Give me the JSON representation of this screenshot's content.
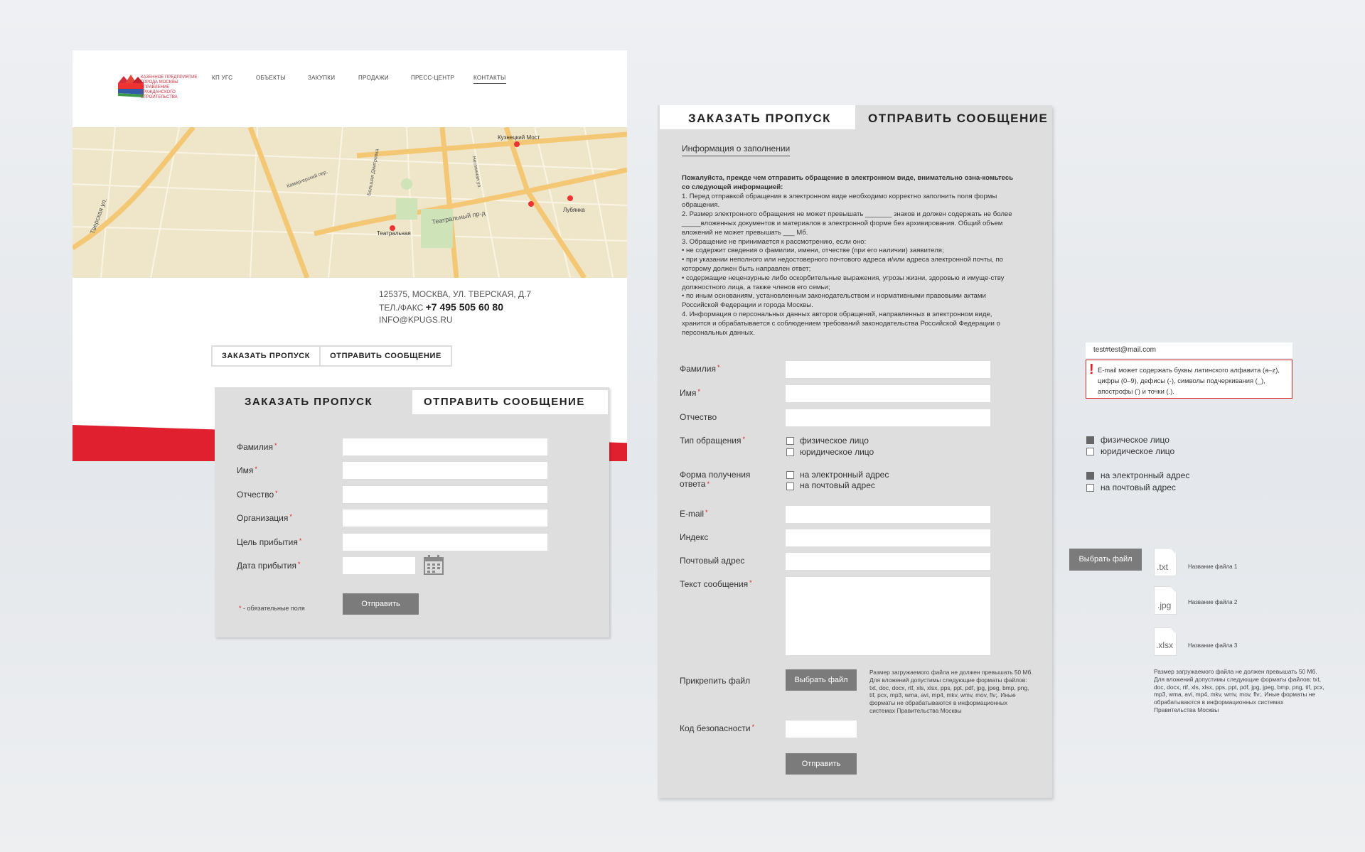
{
  "site": {
    "logo_text": "КАЗЕННОЕ ПРЕДПРИЯТИЕ ГОРОДА МОСКВЫ УПРАВЛЕНИЕ ГРАЖДАНСКОГО СТРОИТЕЛЬСТВА",
    "nav": [
      "КП УГС",
      "ОБЪЕКТЫ",
      "ЗАКУПКИ",
      "ПРОДАЖИ",
      "ПРЕСС-ЦЕНТР",
      "КОНТАКТЫ"
    ],
    "map_labels": [
      "Кузнецкий Мост",
      "Театральная",
      "Театральный пр-д",
      "Тверская ул.",
      "Лубянка",
      "Неглинная ул.",
      "Большая Дмитровка",
      "Камергерский пер."
    ],
    "address": "125375, МОСКВА, УЛ. ТВЕРСКАЯ, Д.7",
    "phone_label": "ТЕЛ./ФАКС",
    "phone": "+7 495 505 60 80",
    "email": "INFO@KPUGS.RU",
    "tab_pass": "ЗАКАЗАТЬ ПРОПУСК",
    "tab_message": "ОТПРАВИТЬ СООБЩЕНИЕ"
  },
  "pass_form": {
    "tab_pass": "ЗАКАЗАТЬ ПРОПУСК",
    "tab_message": "ОТПРАВИТЬ СООБЩЕНИЕ",
    "fields": [
      "Фамилия",
      "Имя",
      "Отчество",
      "Организация",
      "Цель прибытия",
      "Дата прибытия"
    ],
    "required_mark": "*",
    "required_note": "- обязательные поля",
    "submit": "Отправить"
  },
  "message_form": {
    "tab_pass": "ЗАКАЗАТЬ ПРОПУСК",
    "tab_message": "ОТПРАВИТЬ СООБЩЕНИЕ",
    "info_link": "Информация о заполнении",
    "info_heading": "Пожалуйста, прежде чем отправить обращение в электронном виде, внимательно озна-комьтесь со следующей информацией:",
    "info_lines": [
      "1. Перед отправкой обращения в электронном виде необходимо корректно заполнить поля формы обращения.",
      "2. Размер электронного обращения не может превышать _______ знаков и должен содержать не более _____вложенных документов и материалов в электронной форме без архивирования. Общий объем вложений не может превышать ___ Мб.",
      "3. Обращение не принимается к рассмотрению, если оно:",
      "• не содержит сведения о фамилии, имени, отчестве (при его наличии) заявителя;",
      "• при указании неполного или недостоверного почтового адреса и/или адреса электронной почты, по которому должен быть направлен ответ;",
      "• содержащие нецензурные либо оскорбительные выражения, угрозы жизни, здоровью и имуще-ству должностного лица, а также членов его семьи;",
      "• по иным основаниям, установленным законодательством и нормативными правовыми актами Российской Федерации и города Москвы.",
      "4. Информация о персональных данных авторов обращений, направленных в электронном виде, хранится и обрабатывается с соблюдением требований законодательства Российской Федерации о персональных данных."
    ],
    "label_lastname": "Фамилия",
    "label_firstname": "Имя",
    "label_middlename": "Отчество",
    "label_type": "Тип обращения",
    "type_options": [
      "физическое лицо",
      "юридическое лицо"
    ],
    "label_reply": "Форма получения ответа",
    "reply_options": [
      "на электронный адрес",
      "на почтовый адрес"
    ],
    "label_email": "E-mail",
    "label_index": "Индекс",
    "label_postal": "Почтовый адрес",
    "label_text": "Текст сообщения",
    "label_attach": "Прикрепить файл",
    "choose_file": "Выбрать файл",
    "file_note": "Размер загружаемого файла не должен превышать 50 Мб. Для вложений допустимы следующие форматы файлов: txt, doc, docx, rtf, xls, xlsx, pps, ppt, pdf, jpg, jpeg, bmp, png, tif, pcx, mp3, wma, avi, mp4, mkv, wmv, mov, flv;. Иные форматы не обрабатываются в информационных системах Правительства Москвы",
    "label_captcha": "Код безопасности",
    "submit": "Отправить"
  },
  "components": {
    "email_value": "test#test@mail.com",
    "error_mark": "!",
    "error_text": "E-mail может содержать буквы латинского алфавита (a–z), цифры (0–9), дефисы (-), символы подчеркивания (_), апострофы (') и точки (.).",
    "type_options": [
      "физическое лицо",
      "юридическое лицо"
    ],
    "reply_options": [
      "на электронный адрес",
      "на почтовый адрес"
    ],
    "choose_file": "Выбрать файл",
    "files": [
      {
        "ext": ".txt",
        "name": "Название файла 1"
      },
      {
        "ext": ".jpg",
        "name": "Название файла 2"
      },
      {
        "ext": ".xlsx",
        "name": "Название файла 3"
      }
    ],
    "file_note": "Размер загружаемого файла не должен превышать 50 Мб. Для вложений допустимы следующие форматы файлов: txt, doc, docx, rtf, xls, xlsx, pps, ppt, pdf, jpg, jpeg, bmp, png, tif, pcx, mp3, wma, avi, mp4, mkv, wmv, mov, flv;. Иные форматы не обрабатываются в информационных системах Правительства Москвы"
  },
  "colors": {
    "accent_red": "#e0202f",
    "form_gray": "#dedede",
    "button_gray": "#7b7b7b",
    "map_base": "#efe6c9",
    "map_road": "#f3c774"
  }
}
